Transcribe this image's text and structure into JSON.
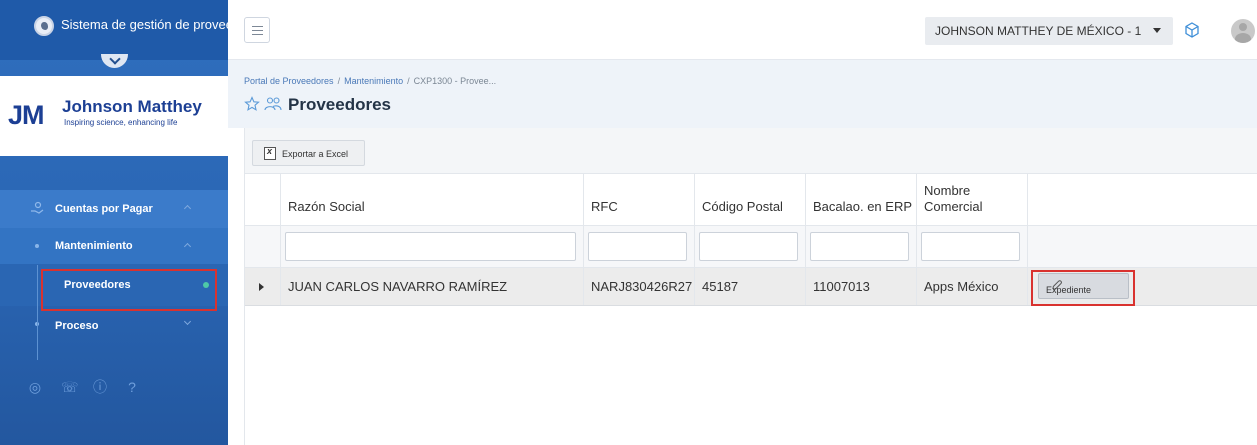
{
  "sidebar": {
    "app_title": "Sistema de gestión de proveedores",
    "logo_initials": "JM",
    "logo_name": "Johnson Matthey",
    "logo_tagline": "Inspiring science, enhancing life",
    "items": [
      {
        "label": "Cuentas por Pagar",
        "icon": "money-hand-icon"
      },
      {
        "label": "Mantenimiento"
      },
      {
        "label": "Proveedores"
      },
      {
        "label": "Proceso"
      }
    ],
    "tools": [
      "globe-icon",
      "phone-icon",
      "info-icon",
      "help-icon"
    ]
  },
  "header": {
    "company": "JOHNSON MATTHEY DE MÉXICO - 1"
  },
  "breadcrumb": {
    "root": "Portal de Proveedores",
    "section": "Mantenimiento",
    "current": "CXP1300 - Provee..."
  },
  "page": {
    "title": "Proveedores"
  },
  "toolbar": {
    "export_label": "Exportar a Excel"
  },
  "table": {
    "columns": [
      "Razón Social",
      "RFC",
      "Código Postal",
      "Bacalao. en ERP",
      "Nombre Comercial"
    ],
    "rows": [
      {
        "razon_social": "JUAN CARLOS NAVARRO RAMÍREZ",
        "rfc": "NARJ830426R27",
        "codigo_postal": "45187",
        "erp": "11007013",
        "nombre_comercial": "Apps México",
        "action_label": "Expediente"
      }
    ]
  },
  "colors": {
    "sidebar": "#2f6fbe",
    "accent": "#4a79b8",
    "highlight": "#d9322f",
    "active_dot": "#4ec9a7"
  }
}
